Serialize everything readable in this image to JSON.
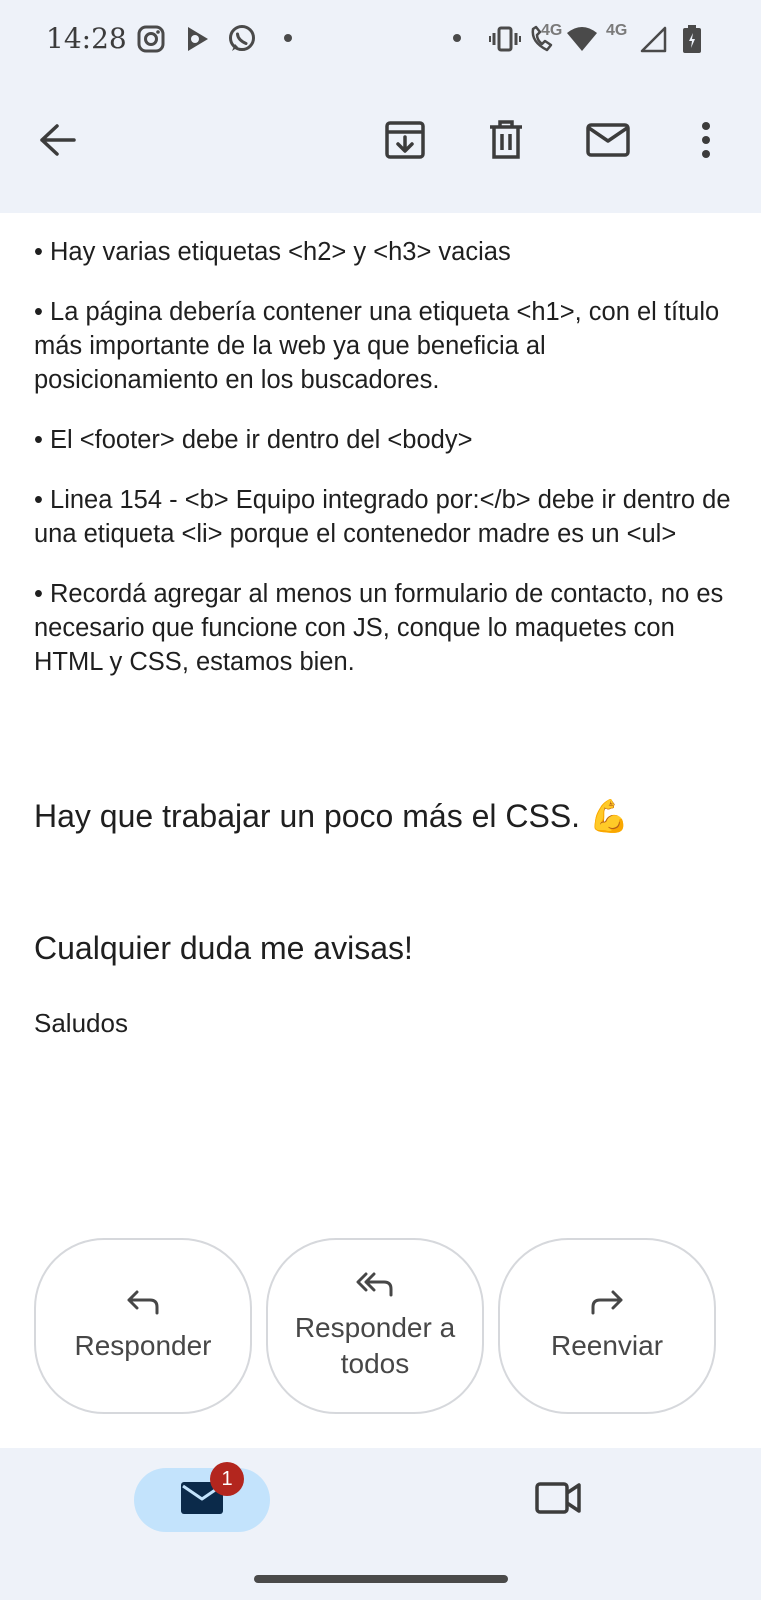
{
  "status_bar": {
    "time": "14:28",
    "network_label_1": "4G",
    "network_label_2": "4G",
    "icons": [
      "instagram-icon",
      "media-app-icon",
      "whatsapp-icon",
      "notification-dot-icon",
      "vibrate-icon",
      "volte-call-icon",
      "wifi-icon",
      "signal-icon",
      "battery-icon"
    ]
  },
  "toolbar": {
    "icons": [
      "back-arrow-icon",
      "archive-icon",
      "delete-icon",
      "mark-unread-icon",
      "more-vert-icon"
    ]
  },
  "email": {
    "bullets": [
      "• Hay varias etiquetas <h2> y <h3> vacias",
      "• La página debería contener una etiqueta <h1>, con el título más importante de la web ya que beneficia al posicionamiento en los buscadores.",
      "• El <footer> debe ir dentro del <body>",
      "• Linea 154 - <b> Equipo integrado por:</b> debe ir dentro de una etiqueta <li> porque el contenedor madre es un <ul>",
      "• Recordá agregar al menos un formulario de contacto, no es necesario que funcione con JS, conque lo maquetes con HTML y CSS, estamos bien."
    ],
    "css_note": "Hay que trabajar un poco más el CSS. 💪",
    "question_note": "Cualquier duda me avisas!",
    "closing": "Saludos"
  },
  "actions": {
    "reply": "Responder",
    "reply_all": "Responder a todos",
    "forward": "Reenviar"
  },
  "bottom_nav": {
    "mail_badge": "1",
    "icons": [
      "mail-icon",
      "video-call-icon"
    ]
  },
  "colors": {
    "background": "#ffffff",
    "chrome": "#eef2f9",
    "pill": "#c3e3fc",
    "badge": "#b3261e",
    "text": "#1f1f1f"
  }
}
